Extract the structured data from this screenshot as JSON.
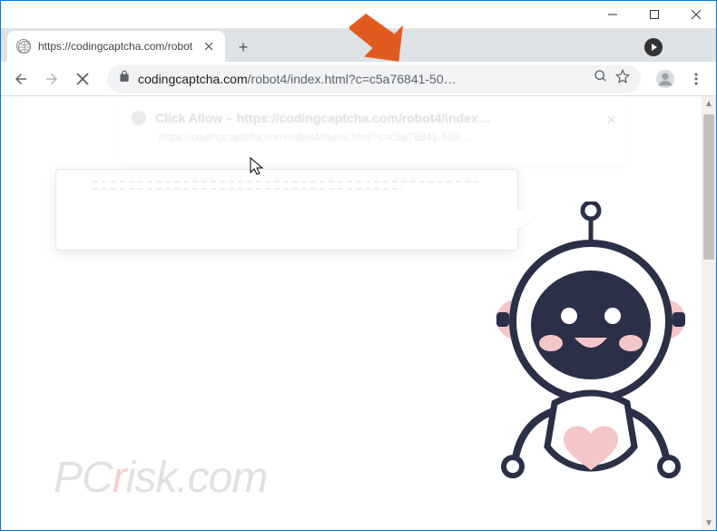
{
  "tab": {
    "title": "https://codingcaptcha.com/robot"
  },
  "url": {
    "domain": "codingcaptcha.com",
    "path": "/robot4/index.html?c=c5a76841-50…"
  },
  "ghost_popup": {
    "title": "Click Allow – https://codingcaptcha.com/robot4/index…",
    "subtitle": "https://codingcaptcha.com/robot4/index.html?c=c5a76841-509…"
  },
  "watermark": {
    "left": "PC",
    "red": "r",
    "right": "isk.com"
  },
  "colors": {
    "robot_dark": "#2b2f47",
    "robot_pink": "#f4c6c8",
    "window_accent": "#0078d7",
    "arrow": "#e25b1e"
  }
}
